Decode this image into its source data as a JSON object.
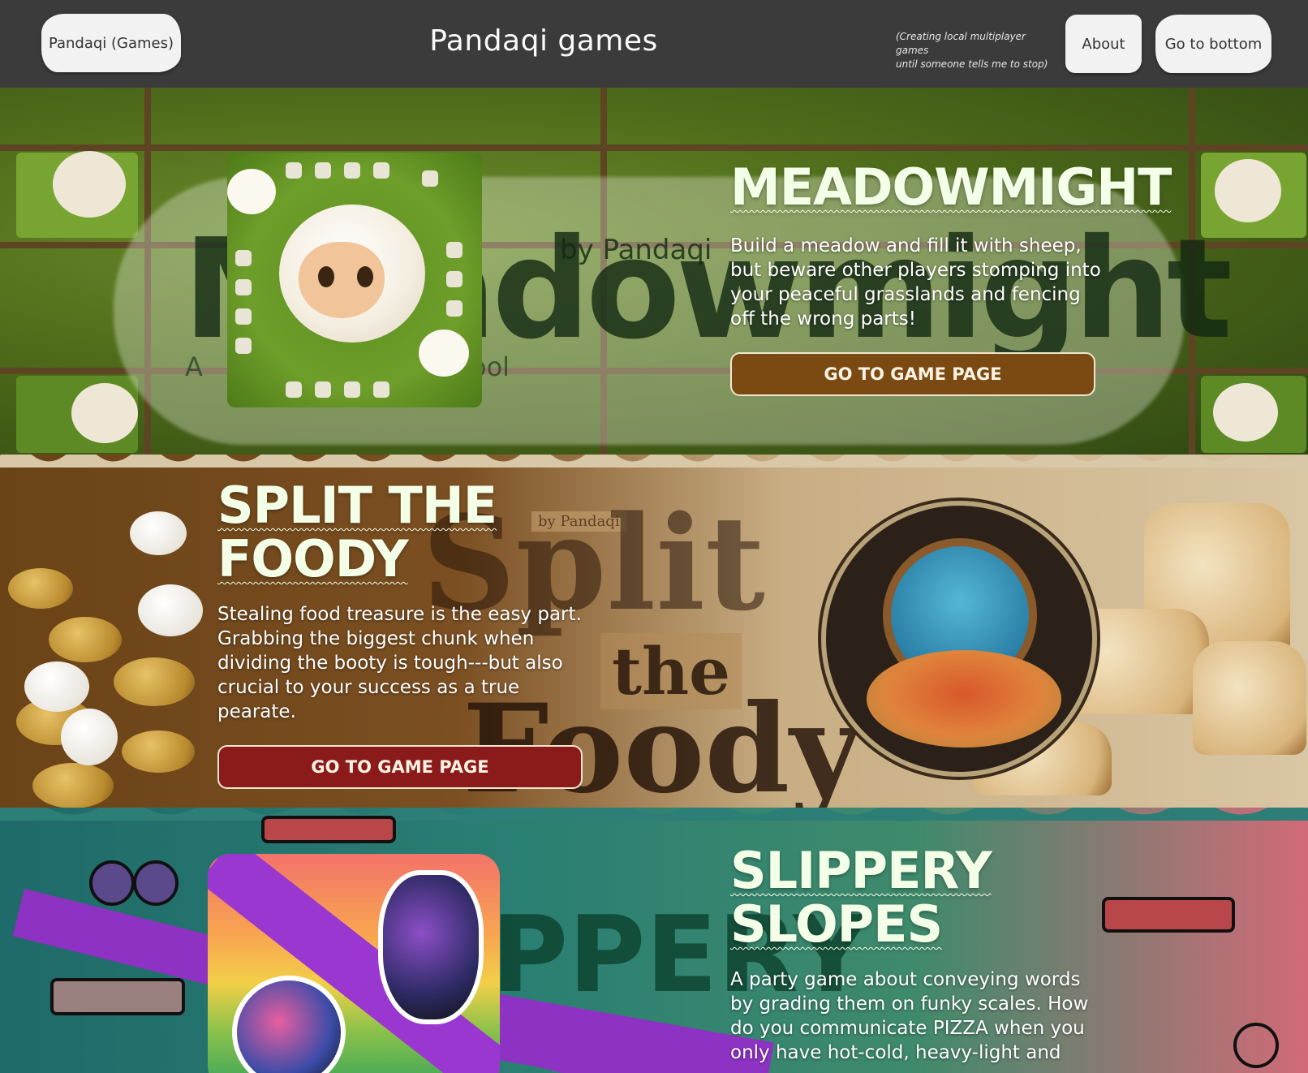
{
  "header": {
    "home_label": "Pandaqi (Games)",
    "site_title": "Pandaqi games",
    "tagline_line1": "(Creating local multiplayer games",
    "tagline_line2": "until someone tells me to stop)",
    "about_label": "About",
    "bottom_label": "Go to bottom"
  },
  "games": [
    {
      "title_line1": "MEADOWMIGHT",
      "description": "Build a meadow and fill it with sheep, but beware other players stomping into your peaceful grasslands and fencing off the wrong parts!",
      "button_label": "GO TO GAME PAGE",
      "accent": "#7a4a12",
      "art_text_big": "Meadowmight",
      "art_text_by": "by Pandaqi",
      "art_text_sub": "A",
      "art_text_sub2": "ool"
    },
    {
      "title_line1": "SPLIT THE",
      "title_line2": "FOODY",
      "description": "Stealing food treasure is the easy part. Grabbing the biggest chunk when dividing the booty is tough---but also crucial to your success as a true pearate.",
      "button_label": "GO TO GAME PAGE",
      "accent": "#8a1b1a",
      "art_text_by": "by Pandaqi",
      "art_text_split": "Split",
      "art_text_the": "the",
      "art_text_foody": "Foody"
    },
    {
      "title_line1": "SLIPPERY",
      "title_line2": "SLOPES",
      "description": "A party game about conveying words by grading them on funky scales. How do you communicate PIZZA when you only have hot-cold, heavy-light and",
      "art_text_big": "PPERY"
    }
  ]
}
